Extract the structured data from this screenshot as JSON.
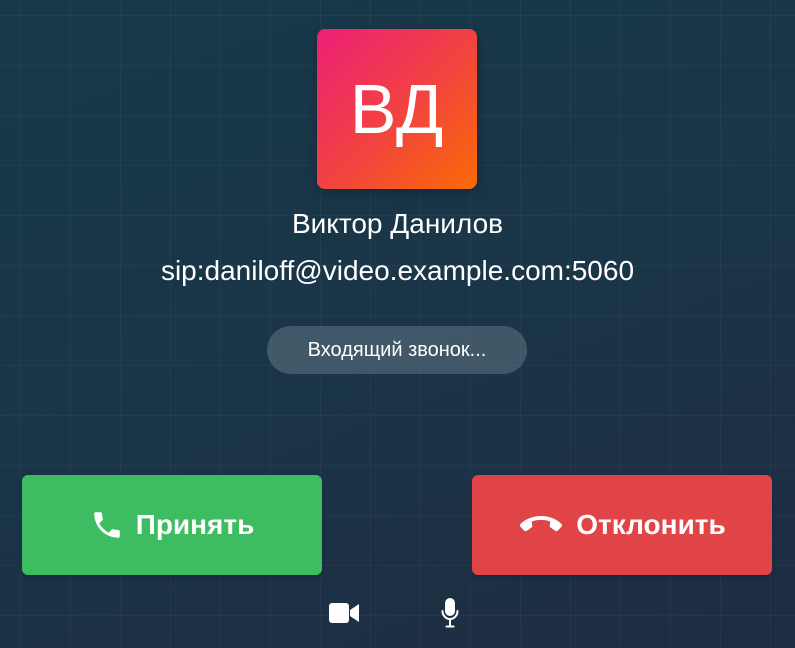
{
  "caller": {
    "initials": "ВД",
    "name": "Виктор Данилов",
    "address": "sip:daniloff@video.example.com:5060",
    "avatar_gradient": [
      "#ec1f77",
      "#f2453d",
      "#fb6a06"
    ]
  },
  "status": {
    "text": "Входящий звонок..."
  },
  "actions": {
    "accept": {
      "label": "Принять",
      "icon": "phone-icon",
      "color": "#3dbc62"
    },
    "decline": {
      "label": "Отклонить",
      "icon": "phone-hangup-icon",
      "color": "#e04446"
    }
  },
  "media_controls": {
    "video_icon": "video-camera-icon",
    "mic_icon": "microphone-icon"
  },
  "colors": {
    "background": "#1a3548",
    "status_badge": "#4a6170"
  }
}
